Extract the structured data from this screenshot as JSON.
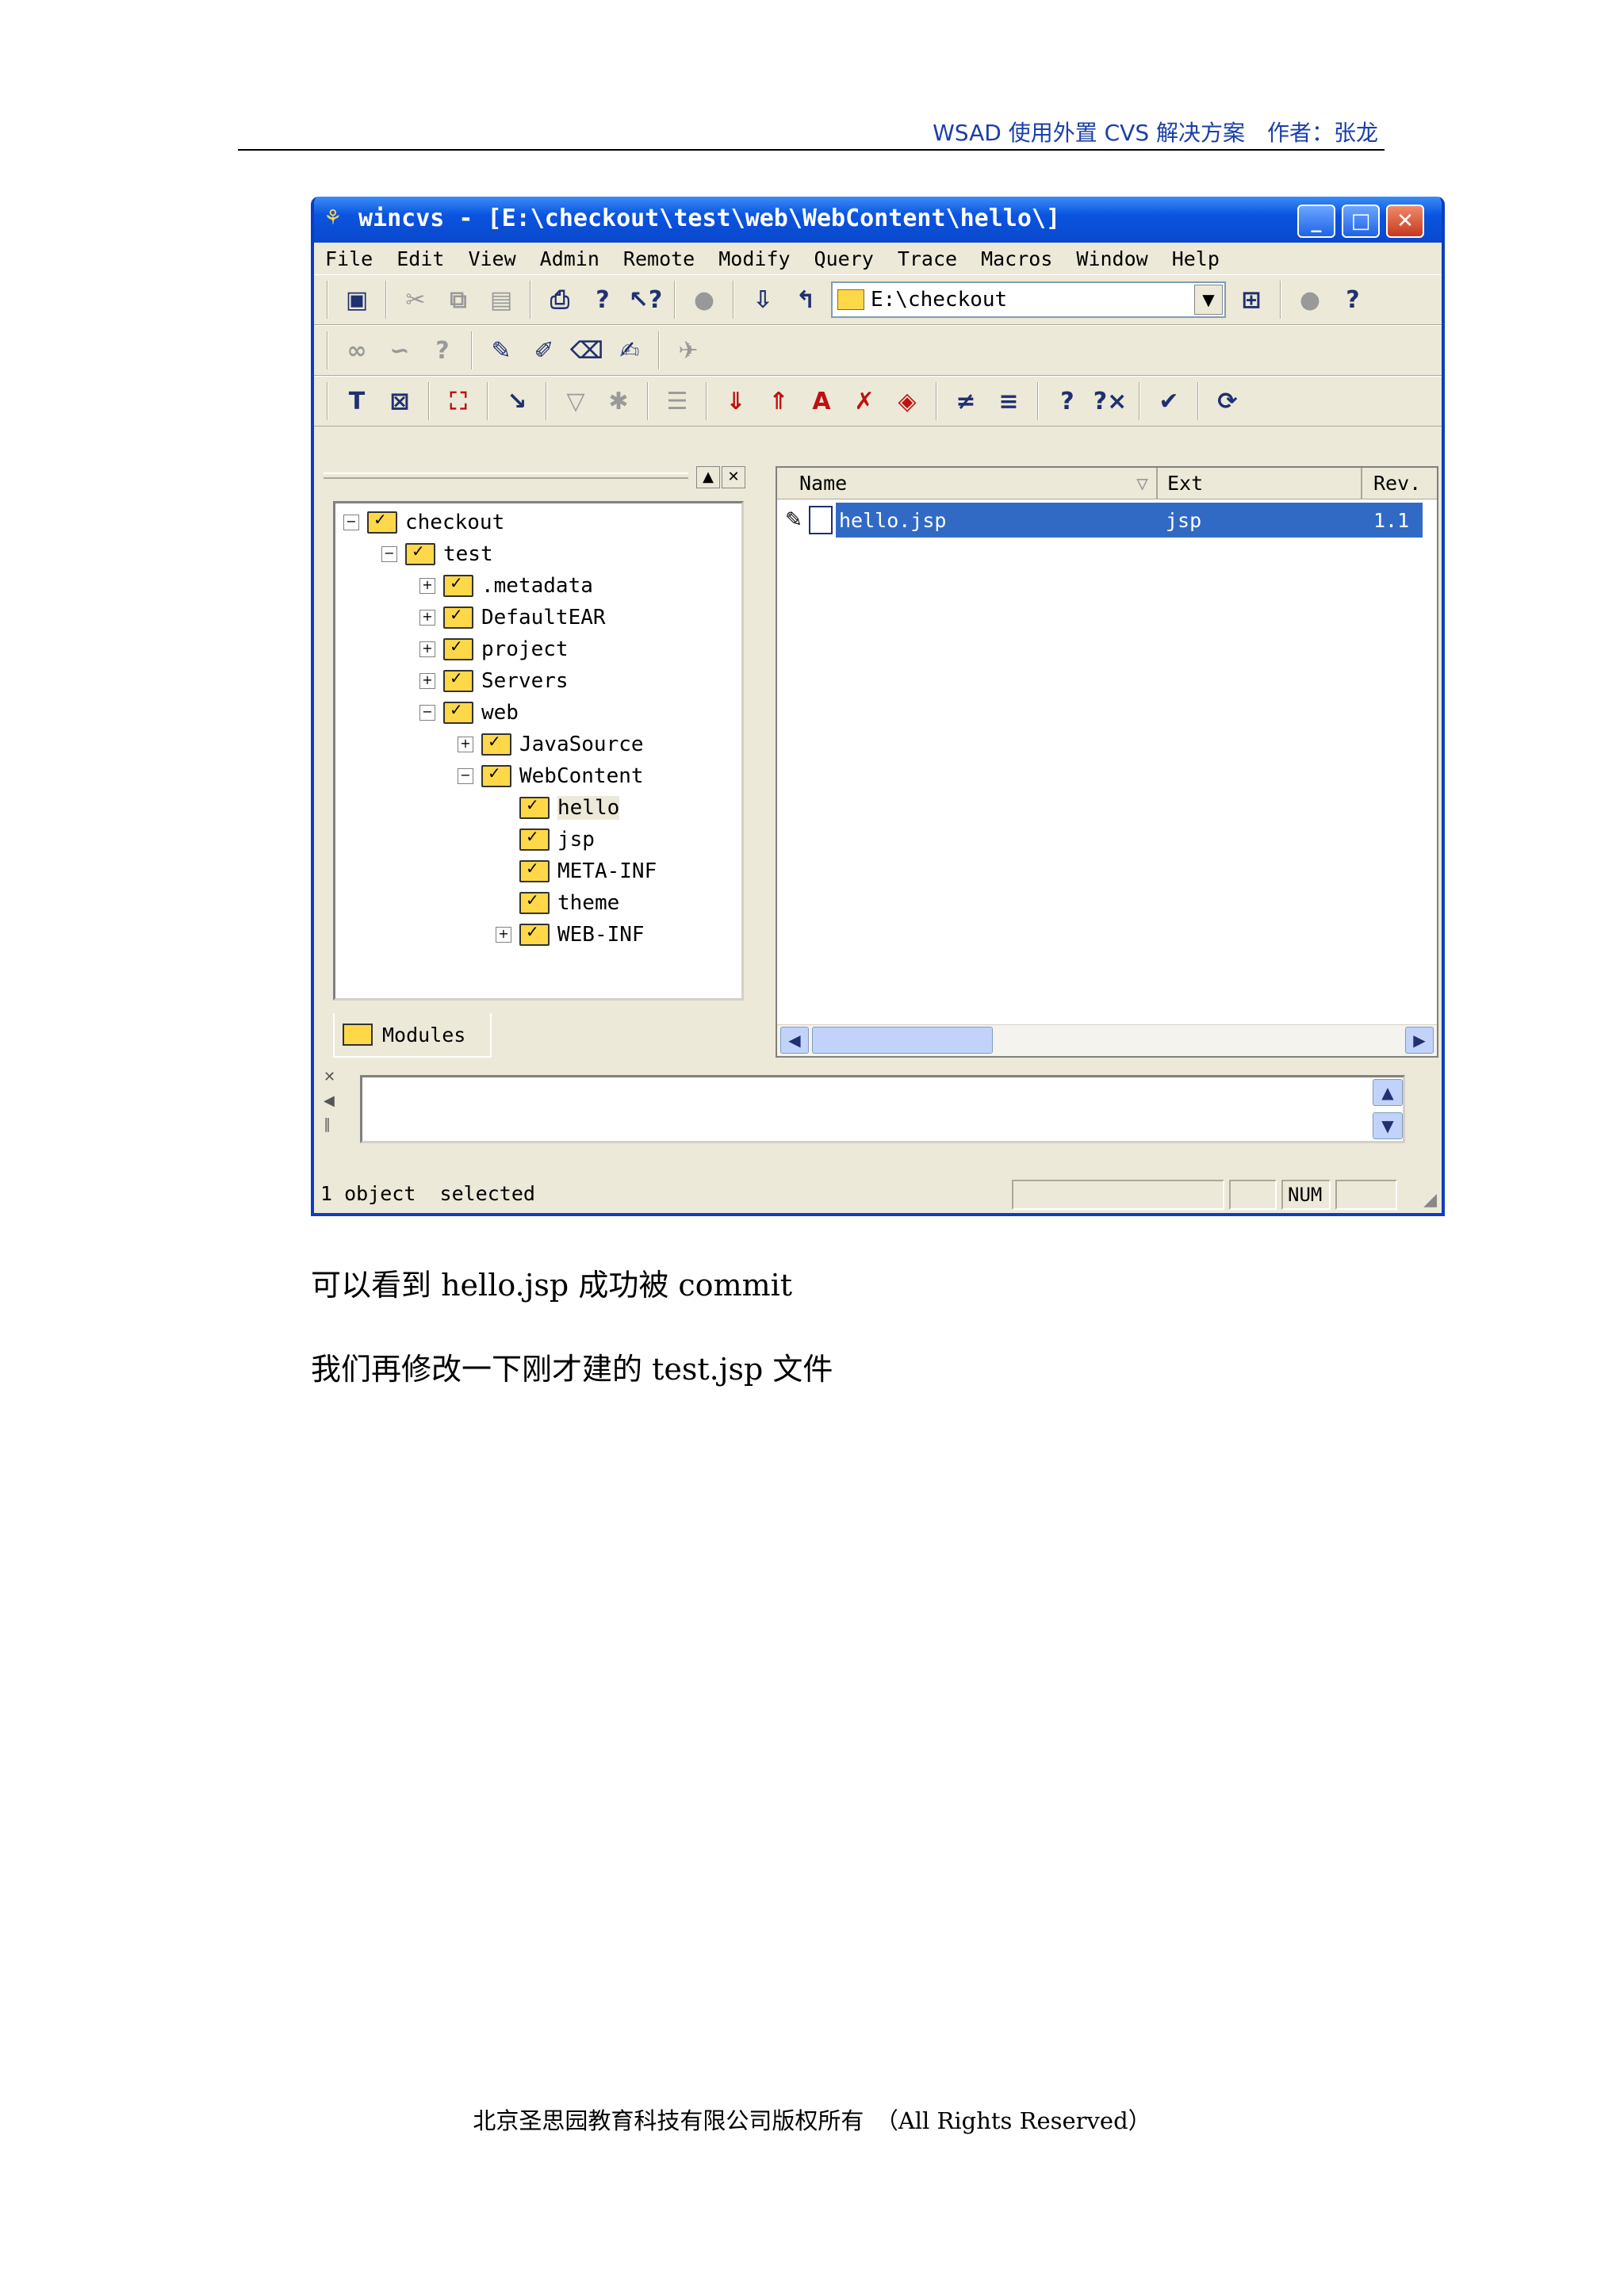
{
  "header": {
    "text": "WSAD 使用外置 CVS 解决方案　作者：张龙"
  },
  "window": {
    "title": "wincvs - [E:\\checkout\\test\\web\\WebContent\\hello\\]",
    "minimize": "_",
    "maximize": "□",
    "close": "✕",
    "menu": [
      "File",
      "Edit",
      "View",
      "Admin",
      "Remote",
      "Modify",
      "Query",
      "Trace",
      "Macros",
      "Window",
      "Help"
    ],
    "path_combo": "E:\\checkout",
    "tree": [
      {
        "label": "checkout",
        "toggle": "−"
      },
      {
        "label": "test",
        "toggle": "−"
      },
      {
        "label": ".metadata",
        "toggle": "+"
      },
      {
        "label": "DefaultEAR",
        "toggle": "+"
      },
      {
        "label": "project",
        "toggle": "+"
      },
      {
        "label": "Servers",
        "toggle": "+"
      },
      {
        "label": "web",
        "toggle": "−"
      },
      {
        "label": "JavaSource",
        "toggle": "+"
      },
      {
        "label": "WebContent",
        "toggle": "−"
      },
      {
        "label": "hello",
        "toggle": ""
      },
      {
        "label": "jsp",
        "toggle": ""
      },
      {
        "label": "META-INF",
        "toggle": ""
      },
      {
        "label": "theme",
        "toggle": ""
      },
      {
        "label": "WEB-INF",
        "toggle": "+"
      }
    ],
    "modules_tab": "Modules",
    "columns": {
      "name": "Name",
      "ext": "Ext",
      "rev": "Rev."
    },
    "files": [
      {
        "name": "hello.jsp",
        "ext": "jsp",
        "rev": "1.1"
      }
    ],
    "status": {
      "text": "1 object  selected",
      "num": "NUM"
    }
  },
  "paragraphs": [
    "可以看到 hello.jsp 成功被 commit",
    "我们再修改一下刚才建的 test.jsp 文件"
  ],
  "footer": "北京圣思园教育科技有限公司版权所有　（All Rights Reserved）"
}
